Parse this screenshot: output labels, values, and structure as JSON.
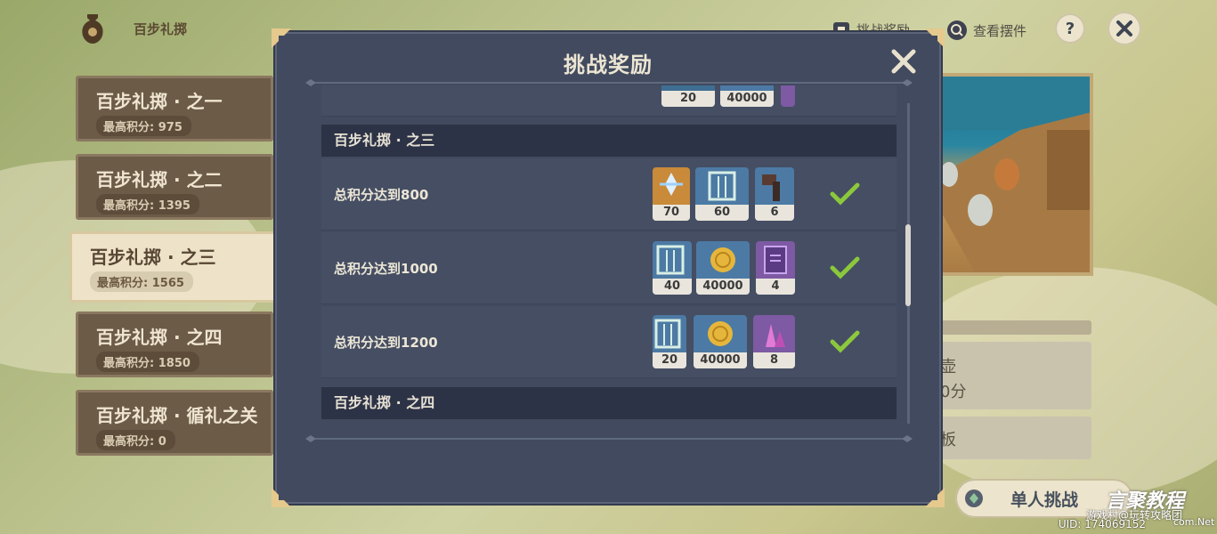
{
  "header": {
    "event_title": "百步礼掷",
    "link_rewards": "挑战奖励",
    "link_view": "查看摆件",
    "help_label": "?"
  },
  "stages": [
    {
      "name": "百步礼掷 · 之一",
      "score": "最高积分: 975"
    },
    {
      "name": "百步礼掷 · 之二",
      "score": "最高积分: 1395"
    },
    {
      "name": "百步礼掷 · 之三",
      "score": "最高积分: 1565",
      "selected": true
    },
    {
      "name": "百步礼掷 · 之四",
      "score": "最高积分: 1850"
    },
    {
      "name": "百步礼掷 · 循礼之关",
      "score": "最高积分: 0"
    }
  ],
  "right_panel": {
    "box1_text": "壶",
    "box1_sub": "0分",
    "box2_text": "板",
    "solo_button": "单人挑战"
  },
  "uid": "UID: 174069152",
  "watermark": {
    "brand": "言聚教程",
    "site": "游戏村@玩转攻略团",
    "url": "com.Net"
  },
  "modal": {
    "title": "挑战奖励",
    "prev_row": {
      "items": [
        {
          "count": "20"
        },
        {
          "count": "40000"
        }
      ]
    },
    "sections": [
      {
        "title": "百步礼掷 · 之三",
        "rows": [
          {
            "condition": "总积分达到800",
            "items": [
              {
                "icon": "primogem-icon",
                "count": "70"
              },
              {
                "icon": "fates-icon",
                "count": "60"
              },
              {
                "icon": "hammer-material-icon",
                "count": "6"
              }
            ],
            "completed": true
          },
          {
            "condition": "总积分达到1000",
            "items": [
              {
                "icon": "fates-icon",
                "count": "40"
              },
              {
                "icon": "mora-icon",
                "count": "40000"
              },
              {
                "icon": "book-icon",
                "count": "4"
              }
            ],
            "completed": true
          },
          {
            "condition": "总积分达到1200",
            "items": [
              {
                "icon": "fates-icon",
                "count": "20"
              },
              {
                "icon": "mora-icon",
                "count": "40000"
              },
              {
                "icon": "crystal-icon",
                "count": "8"
              }
            ],
            "completed": true
          }
        ]
      },
      {
        "title": "百步礼掷 · 之四",
        "rows": []
      }
    ]
  },
  "colors": {
    "modal_bg": "#414a5e",
    "section_bg": "#2d3346",
    "check_green": "#8cc83c",
    "rarity_orange": "#c98a3a",
    "rarity_blue": "#4c7aa4",
    "rarity_purple": "#7d5aa3"
  }
}
